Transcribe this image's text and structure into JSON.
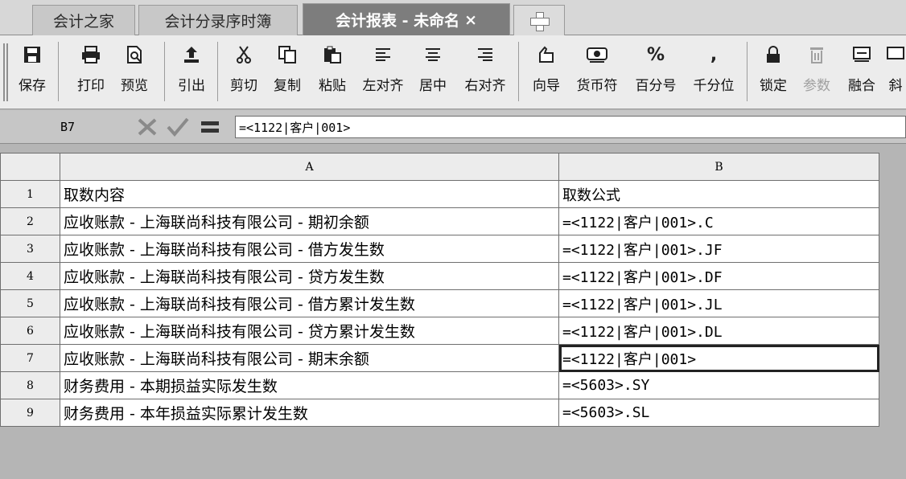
{
  "tabs": [
    {
      "label": "会计之家"
    },
    {
      "label": "会计分录序时簿"
    },
    {
      "label": "会计报表 - 未命名",
      "close": "×"
    }
  ],
  "toolbar": {
    "items": [
      {
        "label": "保存",
        "icon": "save-icon"
      },
      {
        "label": "打印",
        "icon": "print-icon"
      },
      {
        "label": "预览",
        "icon": "preview-icon"
      },
      {
        "label": "引出",
        "icon": "export-icon"
      },
      {
        "label": "剪切",
        "icon": "cut-icon"
      },
      {
        "label": "复制",
        "icon": "copy-icon"
      },
      {
        "label": "粘贴",
        "icon": "paste-icon"
      },
      {
        "label": "左对齐",
        "icon": "align-left-icon"
      },
      {
        "label": "居中",
        "icon": "align-center-icon"
      },
      {
        "label": "右对齐",
        "icon": "align-right-icon"
      },
      {
        "label": "向导",
        "icon": "wizard-icon"
      },
      {
        "label": "货币符",
        "icon": "currency-icon"
      },
      {
        "label": "百分号",
        "icon": "percent-icon"
      },
      {
        "label": "千分位",
        "icon": "thousands-icon"
      },
      {
        "label": "锁定",
        "icon": "lock-icon"
      },
      {
        "label": "参数",
        "icon": "params-icon",
        "disabled": true
      },
      {
        "label": "融合",
        "icon": "merge-icon"
      },
      {
        "label": "斜",
        "icon": "diagonal-icon"
      }
    ]
  },
  "formula_bar": {
    "cell_ref": "B7",
    "formula": "=<1122|客户|001>"
  },
  "grid": {
    "col_headers": [
      "A",
      "B"
    ],
    "rows": [
      {
        "num": "1",
        "a": "取数内容",
        "b": "取数公式"
      },
      {
        "num": "2",
        "a": "应收账款 - 上海联尚科技有限公司 - 期初余额",
        "b": "=<1122|客户|001>.C"
      },
      {
        "num": "3",
        "a": "应收账款 - 上海联尚科技有限公司 - 借方发生数",
        "b": "=<1122|客户|001>.JF"
      },
      {
        "num": "4",
        "a": "应收账款 - 上海联尚科技有限公司 - 贷方发生数",
        "b": "=<1122|客户|001>.DF"
      },
      {
        "num": "5",
        "a": "应收账款 - 上海联尚科技有限公司 - 借方累计发生数",
        "b": "=<1122|客户|001>.JL"
      },
      {
        "num": "6",
        "a": "应收账款 - 上海联尚科技有限公司 - 贷方累计发生数",
        "b": "=<1122|客户|001>.DL"
      },
      {
        "num": "7",
        "a": "应收账款 - 上海联尚科技有限公司 - 期末余额",
        "b": "=<1122|客户|001>"
      },
      {
        "num": "8",
        "a": "财务费用 - 本期损益实际发生数",
        "b": "=<5603>.SY"
      },
      {
        "num": "9",
        "a": "财务费用 - 本年损益实际累计发生数",
        "b": "=<5603>.SL"
      }
    ]
  }
}
